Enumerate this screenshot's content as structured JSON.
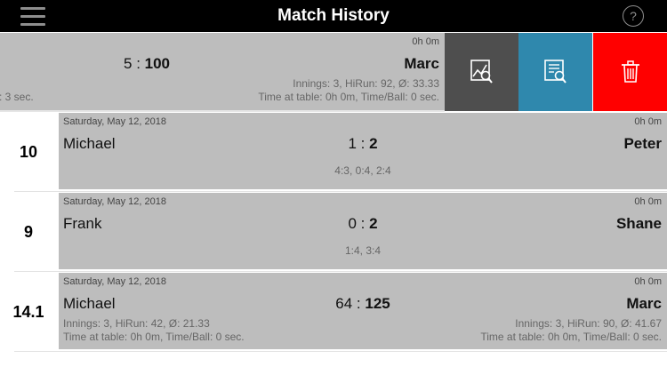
{
  "header": {
    "title": "Match History",
    "help_label": "?"
  },
  "swiped_match": {
    "score_left": "5",
    "score_sep": " : ",
    "score_right": "100",
    "player2": "Marc",
    "duration": "0h 0m",
    "stats_right_1": "Innings: 3, HiRun: 92, Ø: 33.33",
    "stats_right_2": "Time at table: 0h 0m, Time/Ball: 0 sec.",
    "stats_left_clipped": ": 3 sec.",
    "actions": [
      {
        "name": "graph-button",
        "icon": "chart-magnifier-icon",
        "color": "#4e4e4e"
      },
      {
        "name": "details-button",
        "icon": "document-magnifier-icon",
        "color": "#2f88ad"
      },
      {
        "name": "delete-button",
        "icon": "trash-icon",
        "color": "#ff0000"
      }
    ]
  },
  "matches": [
    {
      "number": "10",
      "date": "Saturday, May 12, 2018",
      "duration": "0h 0m",
      "player1": "Michael",
      "player2": "Peter",
      "score_left": "1",
      "score_right": "2",
      "score_sep": " : ",
      "sets": "4:3, 0:4, 2:4"
    },
    {
      "number": "9",
      "date": "Saturday, May 12, 2018",
      "duration": "0h 0m",
      "player1": "Frank",
      "player2": "Shane",
      "score_left": "0",
      "score_right": "2",
      "score_sep": " : ",
      "sets": "1:4, 3:4"
    },
    {
      "number": "14.1",
      "date": "Saturday, May 12, 2018",
      "duration": "0h 0m",
      "player1": "Michael",
      "player2": "Marc",
      "score_left": "64",
      "score_right": "125",
      "score_sep": " : ",
      "stats_left_1": "Innings: 3, HiRun: 42, Ø: 21.33",
      "stats_left_2": "Time at table: 0h 0m, Time/Ball: 0 sec.",
      "stats_right_1": "Innings: 3, HiRun: 90, Ø: 41.67",
      "stats_right_2": "Time at table: 0h 0m, Time/Ball: 0 sec."
    }
  ]
}
